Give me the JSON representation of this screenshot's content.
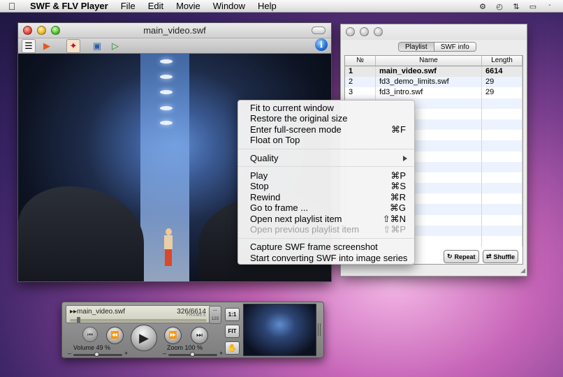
{
  "menubar": {
    "app_name": "SWF & FLV Player",
    "items": [
      "File",
      "Edit",
      "Movie",
      "Window",
      "Help"
    ]
  },
  "video_window": {
    "title": "main_video.swf"
  },
  "context_menu": {
    "group1": [
      {
        "label": "Fit to current window",
        "shortcut": ""
      },
      {
        "label": "Restore the original size",
        "shortcut": ""
      },
      {
        "label": "Enter full-screen mode",
        "shortcut": "⌘F"
      },
      {
        "label": "Float on Top",
        "shortcut": ""
      }
    ],
    "quality_label": "Quality",
    "group2": [
      {
        "label": "Play",
        "shortcut": "⌘P"
      },
      {
        "label": "Stop",
        "shortcut": "⌘S"
      },
      {
        "label": "Rewind",
        "shortcut": "⌘R"
      },
      {
        "label": "Go to frame ...",
        "shortcut": "⌘G"
      },
      {
        "label": "Open next playlist item",
        "shortcut": "⇧⌘N"
      },
      {
        "label": "Open previous playlist item",
        "shortcut": "⇧⌘P"
      }
    ],
    "group3": [
      {
        "label": "Capture SWF frame screenshot",
        "shortcut": ""
      },
      {
        "label": "Start converting SWF into image series",
        "shortcut": ""
      }
    ]
  },
  "playlist": {
    "tabs": [
      "Playlist",
      "SWF info"
    ],
    "columns": [
      "№",
      "Name",
      "Length"
    ],
    "rows": [
      {
        "num": "1",
        "name": "main_video.swf",
        "length": "6614"
      },
      {
        "num": "2",
        "name": "fd3_demo_limits.swf",
        "length": "29"
      },
      {
        "num": "3",
        "name": "fd3_intro.swf",
        "length": "29"
      }
    ],
    "repeat_label": "Repeat",
    "shuffle_label": "Shuffle"
  },
  "controller": {
    "file_name": "main_video.swf",
    "frame_counter": "326/6614",
    "frames_label": "FRAMES",
    "volume_label": "Volume 49 %",
    "zoom_label": "Zoom 100 %",
    "ratio_button": "1:1",
    "fit_button": "FIT",
    "minus": "–",
    "plus": "+",
    "progress": 0.049,
    "volume": 0.49,
    "zoom": 0.5
  }
}
